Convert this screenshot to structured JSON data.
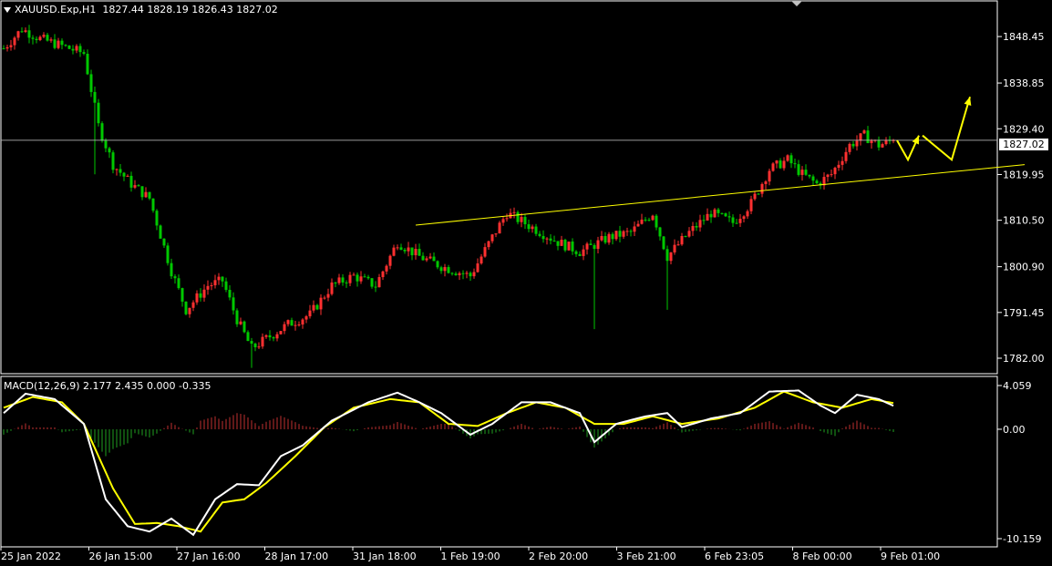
{
  "header": {
    "symbol": "XAUUSD.Exp,H1",
    "ohlc": "1827.44 1828.19 1826.43 1827.02"
  },
  "macd_header": {
    "text": "MACD(12,26,9) 2.177 2.435 0.000 -0.335"
  },
  "current_price_label": "1827.02",
  "colors": {
    "background": "#000000",
    "bull": "#ff3030",
    "bear": "#00c800",
    "trendline": "#ffff00",
    "macd_line": "#ffffff",
    "signal_line": "#ffff00",
    "hist_pos": "#c03030",
    "hist_neg": "#20a020",
    "grid_line": "#c0c0c0"
  },
  "chart_data": [
    {
      "type": "candlestick",
      "title": "XAUUSD.Exp,H1",
      "x_tick_labels": [
        "25 Jan 2022",
        "26 Jan 15:00",
        "27 Jan 16:00",
        "28 Jan 17:00",
        "31 Jan 18:00",
        "1 Feb 19:00",
        "2 Feb 20:00",
        "3 Feb 21:00",
        "6 Feb 23:05",
        "8 Feb 00:00",
        "9 Feb 01:00"
      ],
      "y_tick_labels": [
        "1848.45",
        "1838.85",
        "1829.40",
        "1819.95",
        "1810.50",
        "1800.90",
        "1791.45",
        "1782.00"
      ],
      "ylim": [
        1778.8,
        1856.0
      ],
      "current_price": 1827.02,
      "price_path_anchors": [
        {
          "bar": 0,
          "close": 1846
        },
        {
          "bar": 5,
          "close": 1850
        },
        {
          "bar": 10,
          "close": 1848
        },
        {
          "bar": 22,
          "close": 1845
        },
        {
          "bar": 26,
          "close": 1830
        },
        {
          "bar": 30,
          "close": 1822
        },
        {
          "bar": 35,
          "close": 1818
        },
        {
          "bar": 40,
          "close": 1815
        },
        {
          "bar": 46,
          "close": 1800
        },
        {
          "bar": 50,
          "close": 1792
        },
        {
          "bar": 56,
          "close": 1797
        },
        {
          "bar": 60,
          "close": 1798
        },
        {
          "bar": 64,
          "close": 1790
        },
        {
          "bar": 68,
          "close": 1784
        },
        {
          "bar": 72,
          "close": 1786
        },
        {
          "bar": 78,
          "close": 1789
        },
        {
          "bar": 84,
          "close": 1791
        },
        {
          "bar": 90,
          "close": 1797
        },
        {
          "bar": 96,
          "close": 1799
        },
        {
          "bar": 102,
          "close": 1797
        },
        {
          "bar": 108,
          "close": 1806
        },
        {
          "bar": 114,
          "close": 1803
        },
        {
          "bar": 120,
          "close": 1801
        },
        {
          "bar": 128,
          "close": 1799
        },
        {
          "bar": 134,
          "close": 1807
        },
        {
          "bar": 138,
          "close": 1812
        },
        {
          "bar": 145,
          "close": 1809
        },
        {
          "bar": 152,
          "close": 1806
        },
        {
          "bar": 158,
          "close": 1804
        },
        {
          "bar": 161,
          "close": 1805
        },
        {
          "bar": 166,
          "close": 1807
        },
        {
          "bar": 172,
          "close": 1808
        },
        {
          "bar": 178,
          "close": 1812
        },
        {
          "bar": 182,
          "close": 1803
        },
        {
          "bar": 188,
          "close": 1808
        },
        {
          "bar": 194,
          "close": 1812
        },
        {
          "bar": 200,
          "close": 1810
        },
        {
          "bar": 205,
          "close": 1814
        },
        {
          "bar": 210,
          "close": 1821
        },
        {
          "bar": 215,
          "close": 1823
        },
        {
          "bar": 219,
          "close": 1820
        },
        {
          "bar": 223,
          "close": 1818
        },
        {
          "bar": 227,
          "close": 1820
        },
        {
          "bar": 232,
          "close": 1826
        },
        {
          "bar": 236,
          "close": 1828
        },
        {
          "bar": 240,
          "close": 1826
        },
        {
          "bar": 244,
          "close": 1827.02
        }
      ],
      "spikes": [
        {
          "bar": 162,
          "low": 1788
        },
        {
          "bar": 182,
          "low": 1792
        },
        {
          "bar": 25,
          "low": 1820
        },
        {
          "bar": 68,
          "low": 1780
        }
      ],
      "trendline": {
        "from": {
          "bar": 113,
          "price": 1809.5
        },
        "to": {
          "bar": 280,
          "price": 1822
        }
      },
      "projection_arrows": [
        [
          {
            "bar": 245,
            "price": 1827
          },
          {
            "bar": 248,
            "price": 1823
          },
          {
            "bar": 251,
            "price": 1828
          }
        ],
        [
          {
            "bar": 252,
            "price": 1828
          },
          {
            "bar": 260,
            "price": 1823
          },
          {
            "bar": 265,
            "price": 1836
          }
        ]
      ]
    },
    {
      "type": "histogram+line",
      "title": "MACD(12,26,9)",
      "y_tick_labels": [
        "4.059",
        "0.00",
        "-10.159"
      ],
      "ylim": [
        -10.159,
        4.059
      ],
      "macd_anchors": [
        {
          "bar": 0,
          "value": 1.5
        },
        {
          "bar": 6,
          "value": 3.3
        },
        {
          "bar": 14,
          "value": 2.8
        },
        {
          "bar": 22,
          "value": 0.5
        },
        {
          "bar": 28,
          "value": -6.5
        },
        {
          "bar": 34,
          "value": -9.0
        },
        {
          "bar": 40,
          "value": -9.5
        },
        {
          "bar": 46,
          "value": -8.3
        },
        {
          "bar": 52,
          "value": -9.8
        },
        {
          "bar": 58,
          "value": -6.5
        },
        {
          "bar": 64,
          "value": -5.1
        },
        {
          "bar": 70,
          "value": -5.2
        },
        {
          "bar": 76,
          "value": -2.5
        },
        {
          "bar": 82,
          "value": -1.5
        },
        {
          "bar": 90,
          "value": 0.8
        },
        {
          "bar": 100,
          "value": 2.5
        },
        {
          "bar": 108,
          "value": 3.4
        },
        {
          "bar": 114,
          "value": 2.5
        },
        {
          "bar": 120,
          "value": 1.5
        },
        {
          "bar": 128,
          "value": -0.5
        },
        {
          "bar": 134,
          "value": 0.5
        },
        {
          "bar": 142,
          "value": 2.5
        },
        {
          "bar": 150,
          "value": 2.5
        },
        {
          "bar": 158,
          "value": 1.5
        },
        {
          "bar": 162,
          "value": -1.2
        },
        {
          "bar": 168,
          "value": 0.5
        },
        {
          "bar": 176,
          "value": 1.2
        },
        {
          "bar": 182,
          "value": 1.5
        },
        {
          "bar": 186,
          "value": 0.2
        },
        {
          "bar": 194,
          "value": 1.0
        },
        {
          "bar": 202,
          "value": 1.5
        },
        {
          "bar": 210,
          "value": 3.5
        },
        {
          "bar": 218,
          "value": 3.6
        },
        {
          "bar": 224,
          "value": 2.2
        },
        {
          "bar": 228,
          "value": 1.5
        },
        {
          "bar": 234,
          "value": 3.2
        },
        {
          "bar": 240,
          "value": 2.8
        },
        {
          "bar": 244,
          "value": 2.177
        }
      ],
      "signal_anchors": [
        {
          "bar": 0,
          "value": 2.0
        },
        {
          "bar": 8,
          "value": 3.0
        },
        {
          "bar": 16,
          "value": 2.5
        },
        {
          "bar": 22,
          "value": 0.5
        },
        {
          "bar": 30,
          "value": -5.5
        },
        {
          "bar": 36,
          "value": -8.8
        },
        {
          "bar": 42,
          "value": -8.7
        },
        {
          "bar": 48,
          "value": -9.0
        },
        {
          "bar": 54,
          "value": -9.5
        },
        {
          "bar": 60,
          "value": -6.8
        },
        {
          "bar": 66,
          "value": -6.5
        },
        {
          "bar": 72,
          "value": -5.0
        },
        {
          "bar": 80,
          "value": -2.5
        },
        {
          "bar": 88,
          "value": 0.2
        },
        {
          "bar": 96,
          "value": 2.0
        },
        {
          "bar": 106,
          "value": 2.8
        },
        {
          "bar": 114,
          "value": 2.5
        },
        {
          "bar": 122,
          "value": 0.5
        },
        {
          "bar": 130,
          "value": 0.3
        },
        {
          "bar": 138,
          "value": 1.5
        },
        {
          "bar": 146,
          "value": 2.5
        },
        {
          "bar": 154,
          "value": 2.0
        },
        {
          "bar": 162,
          "value": 0.5
        },
        {
          "bar": 170,
          "value": 0.5
        },
        {
          "bar": 178,
          "value": 1.2
        },
        {
          "bar": 186,
          "value": 0.5
        },
        {
          "bar": 196,
          "value": 1.0
        },
        {
          "bar": 206,
          "value": 2.0
        },
        {
          "bar": 214,
          "value": 3.5
        },
        {
          "bar": 222,
          "value": 2.5
        },
        {
          "bar": 230,
          "value": 2.0
        },
        {
          "bar": 238,
          "value": 2.8
        },
        {
          "bar": 244,
          "value": 2.435
        }
      ]
    }
  ]
}
